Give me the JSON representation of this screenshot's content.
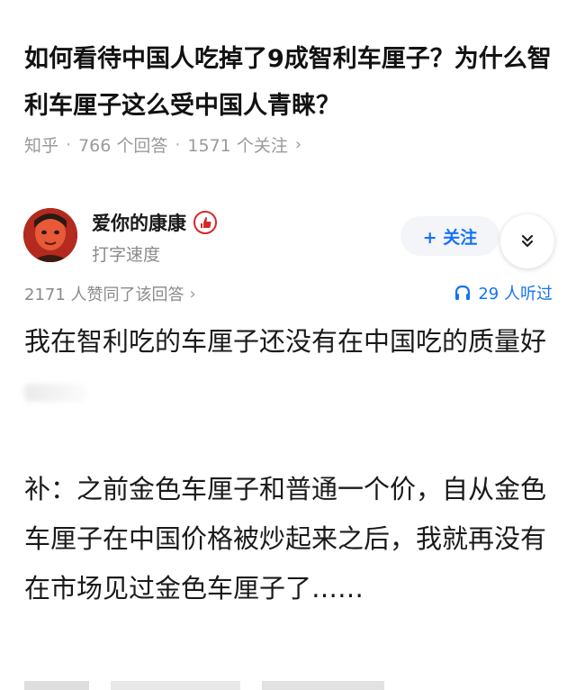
{
  "question": {
    "title": "如何看待中国人吃掉了9成智利车厘子？为什么智利车厘子这么受中国人青睐？",
    "source": "知乎",
    "answers_count": "766 个回答",
    "followers_count": "1571 个关注"
  },
  "author": {
    "name": "爱你的康康",
    "subtitle": "打字速度",
    "follow_label": "+ 关注"
  },
  "stats": {
    "upvotes": "2171 人赞同了该回答",
    "listeners": "29 人听过"
  },
  "answer": {
    "paragraph1": "我在智利吃的车厘子还没有在中国吃的质量好",
    "paragraph2": "补：之前金色车厘子和普通一个价，自从金色车厘子在中国价格被炒起来之后，我就再没有在市场见过金色车厘子了……"
  },
  "colors": {
    "accent": "#1772f6",
    "badge": "#d22a2a",
    "muted": "#8a8a8a"
  },
  "icons": [
    "chevron-right-icon",
    "red-badge-icon",
    "chevron-double-down-icon",
    "headphones-icon"
  ]
}
